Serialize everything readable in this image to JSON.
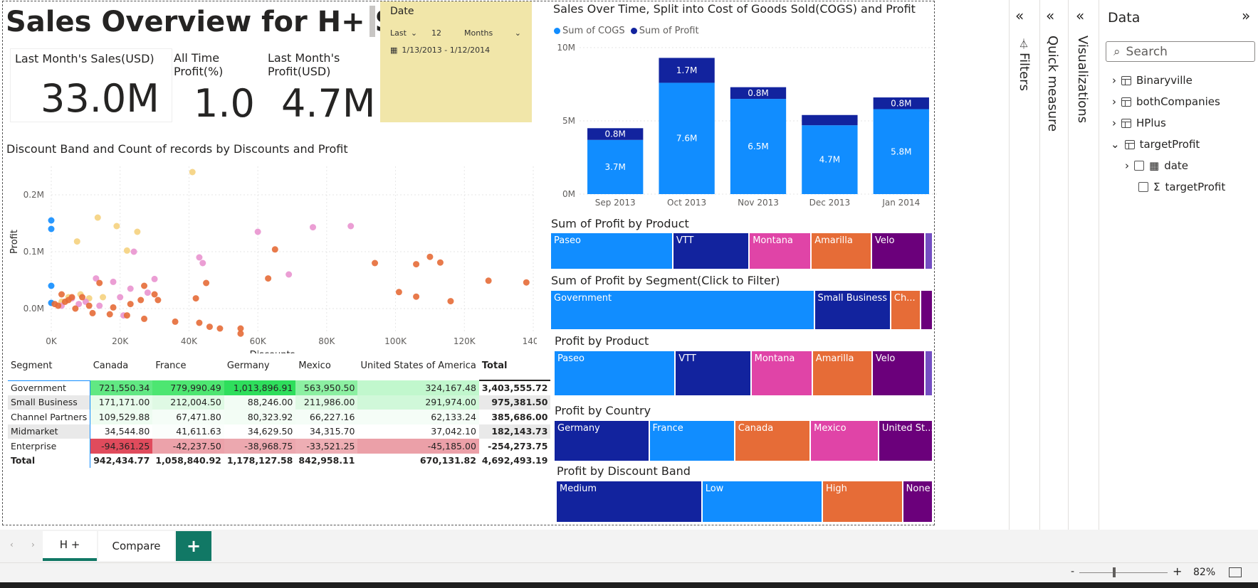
{
  "report": {
    "title": "Sales Overview for H+ Sport",
    "cards": [
      {
        "label": "Last Month's Sales(USD)",
        "value": "33.0M"
      },
      {
        "label": "All Time Profit(%)",
        "value": "1.0"
      },
      {
        "label": "Last Month's Profit(USD)",
        "value": "4.7M"
      }
    ],
    "date_slicer": {
      "title": "Date",
      "relative": "Last",
      "count": "12",
      "unit": "Months",
      "range": "1/13/2013 - 1/12/2014"
    }
  },
  "colors": {
    "cogs": "#118dff",
    "profit": "#12239e",
    "paseo": "#118dff",
    "vtt": "#12239e",
    "montana": "#e044a7",
    "amarilla": "#e66c37",
    "velo": "#6b007b",
    "other": "#744ec2"
  },
  "scatter": {
    "title": "Discount Band and Count of records by Discounts and Profit",
    "chart_data": {
      "type": "scatter",
      "xlabel": "Discounts",
      "ylabel": "Profit",
      "xlim": [
        0,
        140000
      ],
      "ylim": [
        -0.04,
        0.25
      ],
      "x_ticks": [
        "0K",
        "20K",
        "40K",
        "60K",
        "80K",
        "100K",
        "120K",
        "140K"
      ],
      "y_ticks": [
        "0.0M",
        "0.1M",
        "0.2M"
      ],
      "series": [
        {
          "color": "#118dff",
          "points": [
            [
              0,
              0.155
            ],
            [
              0,
              0.14
            ],
            [
              0,
              0.04
            ],
            [
              0,
              0.01
            ]
          ]
        },
        {
          "color": "#f5d27e",
          "points": [
            [
              41000,
              0.24
            ],
            [
              13500,
              0.16
            ],
            [
              19000,
              0.145
            ],
            [
              25000,
              0.135
            ],
            [
              7500,
              0.118
            ],
            [
              22000,
              0.102
            ],
            [
              5000,
              0.02
            ],
            [
              8500,
              0.025
            ],
            [
              3000,
              0.012
            ],
            [
              11000,
              0.018
            ],
            [
              15000,
              0.02
            ]
          ]
        },
        {
          "color": "#e994cf",
          "points": [
            [
              24000,
              0.1
            ],
            [
              60000,
              0.135
            ],
            [
              76000,
              0.143
            ],
            [
              87000,
              0.145
            ],
            [
              43000,
              0.09
            ],
            [
              44000,
              0.08
            ],
            [
              69000,
              0.06
            ],
            [
              30000,
              0.052
            ],
            [
              13000,
              0.053
            ],
            [
              18000,
              0.047
            ],
            [
              23000,
              0.035
            ],
            [
              20000,
              0.02
            ],
            [
              28000,
              0.028
            ],
            [
              10000,
              0.012
            ],
            [
              14000,
              0.005
            ],
            [
              21000,
              -0.012
            ],
            [
              3000,
              0.005
            ],
            [
              6000,
              0.018
            ],
            [
              8000,
              0.008
            ]
          ]
        },
        {
          "color": "#e66c37",
          "points": [
            [
              65000,
              0.104
            ],
            [
              94000,
              0.08
            ],
            [
              106000,
              0.078
            ],
            [
              110000,
              0.091
            ],
            [
              113000,
              0.081
            ],
            [
              63000,
              0.053
            ],
            [
              101000,
              0.029
            ],
            [
              106000,
              0.021
            ],
            [
              116000,
              0.013
            ],
            [
              127000,
              0.049
            ],
            [
              138000,
              0.046
            ],
            [
              45000,
              0.045
            ],
            [
              42000,
              0.018
            ],
            [
              36000,
              -0.023
            ],
            [
              43000,
              -0.025
            ],
            [
              46000,
              -0.032
            ],
            [
              49000,
              -0.035
            ],
            [
              55000,
              -0.035
            ],
            [
              55000,
              -0.044
            ],
            [
              27000,
              0.04
            ],
            [
              30000,
              0.025
            ],
            [
              31000,
              0.015
            ],
            [
              26000,
              0.015
            ],
            [
              23000,
              0.008
            ],
            [
              18000,
              0.002
            ],
            [
              22000,
              -0.012
            ],
            [
              27000,
              -0.018
            ],
            [
              17000,
              -0.01
            ],
            [
              12000,
              -0.008
            ],
            [
              14000,
              0.045
            ],
            [
              9000,
              0.02
            ],
            [
              6000,
              0.02
            ],
            [
              4000,
              0.012
            ],
            [
              2000,
              0.005
            ],
            [
              1000,
              0.008
            ],
            [
              7000,
              0.0
            ],
            [
              5000,
              0.015
            ],
            [
              3000,
              0.025
            ],
            [
              11000,
              0.005
            ]
          ]
        }
      ]
    }
  },
  "matrix": {
    "headers": [
      "Segment",
      "Canada",
      "France",
      "Germany",
      "Mexico",
      "United States of America",
      "Total"
    ],
    "rows": [
      {
        "segment": "Government",
        "values": [
          "721,550.34",
          "779,990.49",
          "1,013,896.91",
          "563,950.50",
          "324,167.48"
        ],
        "total": "3,403,555.72",
        "bg": [
          "#61e883",
          "#4de671",
          "#2ede5c",
          "#8cf0a2",
          "#c1f7cd"
        ]
      },
      {
        "segment": "Small Business",
        "values": [
          "171,171.00",
          "212,004.50",
          "88,246.00",
          "211,986.00",
          "291,974.00"
        ],
        "total": "975,381.50",
        "bg": [
          "#e7fbeb",
          "#dff9e4",
          "#f2fcf4",
          "#dff9e4",
          "#d0f8d9"
        ]
      },
      {
        "segment": "Channel Partners",
        "values": [
          "109,529.88",
          "67,471.80",
          "80,323.92",
          "66,227.16",
          "62,133.24"
        ],
        "total": "385,686.00",
        "bg": [
          "#eefcf1",
          "#f5fdf7",
          "#f3fdf5",
          "#f5fdf7",
          "#f5fdf7"
        ]
      },
      {
        "segment": "Midmarket",
        "values": [
          "34,544.80",
          "41,611.63",
          "34,629.50",
          "34,315.70",
          "37,042.10"
        ],
        "total": "182,143.73",
        "bg": [
          "#ffffff",
          "#fbfefc",
          "#ffffff",
          "#ffffff",
          "#ffffff"
        ]
      },
      {
        "segment": "Enterprise",
        "values": [
          "-94,361.25",
          "-42,237.50",
          "-38,968.75",
          "-33,521.25",
          "-45,185.00"
        ],
        "total": "-254,273.75",
        "bg": [
          "#e04b5c",
          "#eca2aa",
          "#eca8af",
          "#eeaeb4",
          "#eba0a8"
        ]
      }
    ],
    "total_row": {
      "segment": "Total",
      "values": [
        "942,434.77",
        "1,058,840.92",
        "1,178,127.58",
        "842,958.11",
        "670,131.82"
      ],
      "total": "4,692,493.19"
    }
  },
  "barchart": {
    "title": "Sales Over Time, Split into Cost of Goods Sold(COGS) and Profit",
    "legend": [
      "Sum of COGS",
      "Sum of Profit"
    ],
    "chart_data": {
      "type": "bar",
      "stacked": true,
      "categories": [
        "Sep 2013",
        "Oct 2013",
        "Nov 2013",
        "Dec 2013",
        "Jan 2014"
      ],
      "series": [
        {
          "name": "Sum of COGS",
          "values": [
            3.7,
            7.6,
            6.5,
            4.7,
            5.8
          ],
          "labels": [
            "3.7M",
            "7.6M",
            "6.5M",
            "4.7M",
            "5.8M"
          ]
        },
        {
          "name": "Sum of Profit",
          "values": [
            0.8,
            1.7,
            0.8,
            0.7,
            0.8
          ],
          "labels": [
            "0.8M",
            "1.7M",
            "0.8M",
            "",
            "0.8M"
          ]
        }
      ],
      "y_ticks": [
        "0M",
        "5M",
        "10M"
      ],
      "ylim": [
        0,
        10
      ]
    }
  },
  "treemaps": [
    {
      "title": "Sum of Profit by Product",
      "items": [
        {
          "label": "Paseo",
          "share": 0.32,
          "color": "#118dff"
        },
        {
          "label": "VTT",
          "share": 0.2,
          "color": "#12239e"
        },
        {
          "label": "Montana",
          "share": 0.162,
          "color": "#e044a7"
        },
        {
          "label": "Amarilla",
          "share": 0.158,
          "color": "#e66c37"
        },
        {
          "label": "Velo",
          "share": 0.14,
          "color": "#6b007b"
        },
        {
          "label": "",
          "share": 0.02,
          "color": "#744ec2"
        }
      ]
    },
    {
      "title": "Sum of Profit by Segment(Click to Filter)",
      "items": [
        {
          "label": "Government",
          "share": 0.69,
          "color": "#118dff"
        },
        {
          "label": "Small Business",
          "share": 0.2,
          "color": "#12239e"
        },
        {
          "label": "Ch...",
          "share": 0.078,
          "color": "#e66c37"
        },
        {
          "label": "",
          "share": 0.032,
          "color": "#6b007b"
        }
      ]
    },
    {
      "title": "Profit by Product",
      "items": [
        {
          "label": "Paseo",
          "share": 0.32,
          "color": "#118dff"
        },
        {
          "label": "VTT",
          "share": 0.2,
          "color": "#12239e"
        },
        {
          "label": "Montana",
          "share": 0.162,
          "color": "#e044a7"
        },
        {
          "label": "Amarilla",
          "share": 0.158,
          "color": "#e66c37"
        },
        {
          "label": "Velo",
          "share": 0.14,
          "color": "#6b007b"
        },
        {
          "label": "",
          "share": 0.02,
          "color": "#744ec2"
        }
      ]
    },
    {
      "title": "Profit by Country",
      "items": [
        {
          "label": "Germany",
          "share": 0.251,
          "color": "#12239e"
        },
        {
          "label": "France",
          "share": 0.226,
          "color": "#118dff"
        },
        {
          "label": "Canada",
          "share": 0.2,
          "color": "#e66c37"
        },
        {
          "label": "Mexico",
          "share": 0.18,
          "color": "#e044a7"
        },
        {
          "label": "United St...",
          "share": 0.143,
          "color": "#6b007b"
        }
      ]
    },
    {
      "title": "Profit by Discount Band",
      "items": [
        {
          "label": "Medium",
          "share": 0.387,
          "color": "#12239e"
        },
        {
          "label": "Low",
          "share": 0.32,
          "color": "#118dff"
        },
        {
          "label": "High",
          "share": 0.213,
          "color": "#e66c37"
        },
        {
          "label": "None",
          "share": 0.08,
          "color": "#6b007b"
        }
      ]
    }
  ],
  "panes": {
    "filters": "Filters",
    "quick_measure": "Quick measure",
    "visualizations": "Visualizations",
    "data": {
      "title": "Data",
      "search_placeholder": "Search",
      "tables": [
        "Binaryville",
        "bothCompanies",
        "HPlus",
        "targetProfit"
      ],
      "fields": [
        "date",
        "targetProfit"
      ]
    }
  },
  "tabs": [
    "H +",
    "Compare"
  ],
  "status": {
    "zoom": "82%"
  }
}
